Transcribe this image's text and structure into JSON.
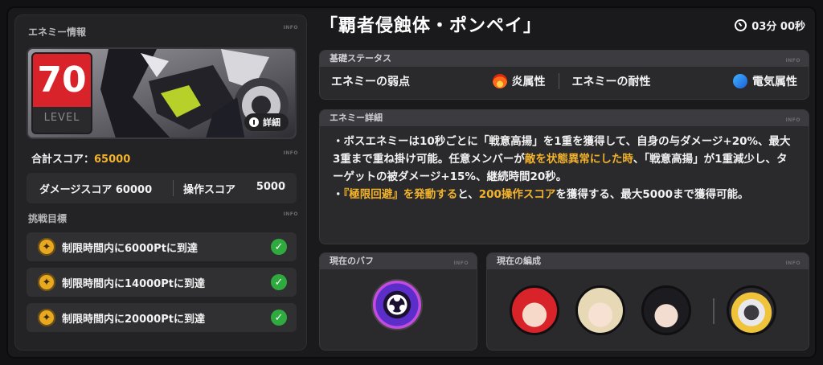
{
  "left": {
    "enemy_info_label": "エネミー情報",
    "info_tag": "INFO",
    "level": "70",
    "level_label": "LEVEL",
    "detail_button": "詳細",
    "total_score_label": "合計スコア：",
    "total_score_value": "65000",
    "damage_score_label": "ダメージスコア",
    "damage_score_value": "60000",
    "operation_score_label": "操作スコア",
    "operation_score_value": "5000",
    "challenge_label": "挑戦目標",
    "objectives": [
      {
        "text": "制限時間内に6000Ptに到達"
      },
      {
        "text": "制限時間内に14000Ptに到達"
      },
      {
        "text": "制限時間内に20000Ptに到達"
      }
    ]
  },
  "header": {
    "title": "「覇者侵蝕体・ポンペイ」",
    "timer": "03分 00秒"
  },
  "basic_status": {
    "label": "基礎ステータス",
    "weakness_label": "エネミーの弱点",
    "weakness_value": "炎属性",
    "resist_label": "エネミーの耐性",
    "resist_value": "電気属性"
  },
  "enemy_detail": {
    "label": "エネミー詳細",
    "p1_a": "・ボスエネミーは10秒ごとに「戦意高揚」を1重を獲得して、自身の与ダメージ+20%、最大3重まで重ね掛け可能。任意メンバーが",
    "p1_hl": "敵を状態異常にした時",
    "p1_b": "、「戦意高揚」が1重減少し、ターゲットの被ダメージ+15%、継続時間20秒。",
    "p2_a": "・",
    "p2_hl1": "『極限回避』を発動する",
    "p2_b": "と、",
    "p2_hl2": "200操作スコア",
    "p2_c": "を獲得する、最大5000まで獲得可能。"
  },
  "buff": {
    "label": "現在のバフ"
  },
  "team": {
    "label": "現在の編成"
  },
  "colors": {
    "accent": "#f3b32a",
    "level_red": "#d8232a",
    "check_green": "#2faa3f"
  }
}
